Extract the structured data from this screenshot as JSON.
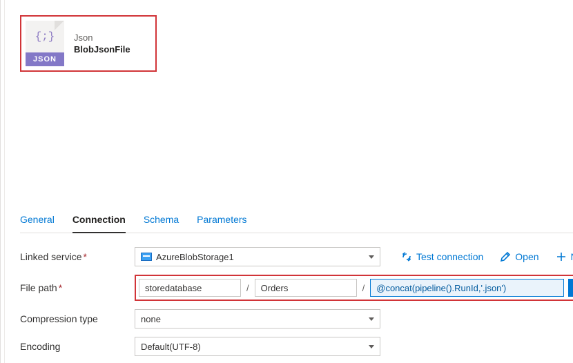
{
  "icons": {
    "json_glyph": "{;}",
    "json_band": "JSON"
  },
  "dataset": {
    "type": "Json",
    "name": "BlobJsonFile"
  },
  "tabs": {
    "general": "General",
    "connection": "Connection",
    "schema": "Schema",
    "parameters": "Parameters"
  },
  "form": {
    "linked_service": {
      "label": "Linked service",
      "value": "AzureBlobStorage1"
    },
    "actions": {
      "test": "Test connection",
      "open": "Open",
      "new": "New"
    },
    "file_path": {
      "label": "File path",
      "container": "storedatabase",
      "directory": "Orders",
      "file_expression": "@concat(pipeline().RunId,'.json')"
    },
    "compression": {
      "label": "Compression type",
      "value": "none"
    },
    "encoding": {
      "label": "Encoding",
      "value": "Default(UTF-8)"
    }
  }
}
